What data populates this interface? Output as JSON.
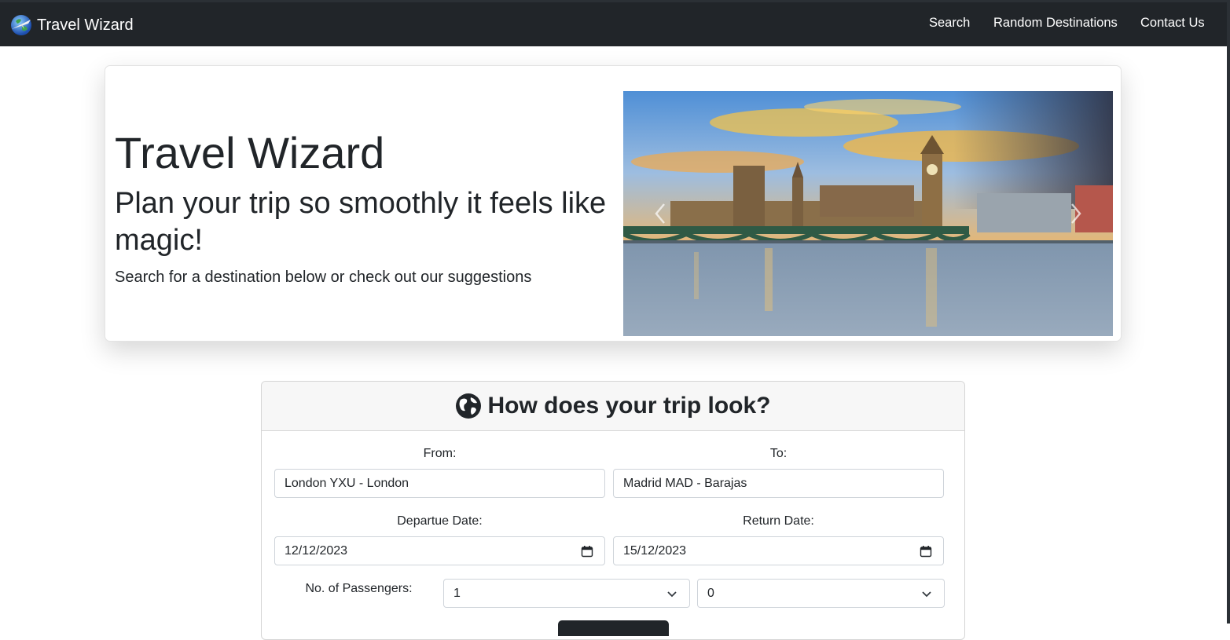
{
  "navbar": {
    "brand": "Travel Wizard",
    "links": [
      "Search",
      "Random Destinations",
      "Contact Us"
    ]
  },
  "hero": {
    "title": "Travel Wizard",
    "subtitle": "Plan your trip so smoothly it feels like magic!",
    "lead": "Search for a destination below or check out our suggestions"
  },
  "search_form": {
    "heading": "How does your trip look?",
    "from_label": "From:",
    "from_value": "London YXU - London",
    "to_label": "To:",
    "to_value": "Madrid MAD - Barajas",
    "departure_label": "Departue Date:",
    "departure_value": "12/12/2023",
    "return_label": "Return Date:",
    "return_value": "15/12/2023",
    "passengers_label": "No. of Passengers:",
    "passengers_primary_value": "1",
    "passengers_secondary_value": "0"
  },
  "icons": {
    "brand_logo": "earth-airplane-icon",
    "heading_icon": "globe-icon",
    "date_picker": "calendar-icon",
    "select_arrow": "chevron-down-icon",
    "carousel_prev": "chevron-left-icon",
    "carousel_next": "chevron-right-icon"
  },
  "colors": {
    "navbar_bg": "#212529",
    "navbar_text": "#ffffff",
    "header_bg": "#f7f7f7",
    "text": "#212529"
  }
}
